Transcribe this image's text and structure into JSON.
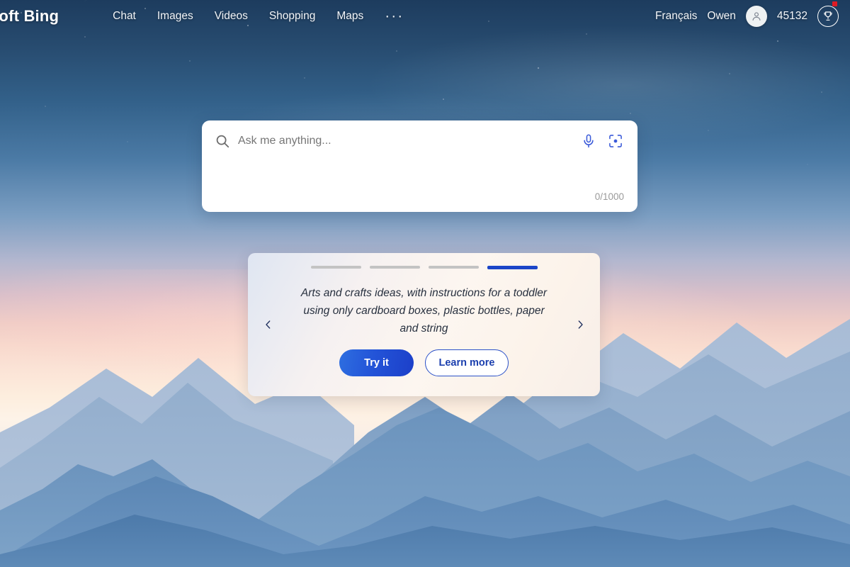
{
  "header": {
    "brand": "soft Bing",
    "nav": [
      {
        "label": "Chat",
        "name": "nav-chat"
      },
      {
        "label": "Images",
        "name": "nav-images"
      },
      {
        "label": "Videos",
        "name": "nav-videos"
      },
      {
        "label": "Shopping",
        "name": "nav-shopping"
      },
      {
        "label": "Maps",
        "name": "nav-maps"
      }
    ],
    "more_label": "···",
    "language": "Français",
    "account_name": "Owen",
    "rewards_points": "45132",
    "avatar_icon": "person-icon",
    "rewards_icon": "trophy-icon",
    "notification_badge": true
  },
  "search": {
    "placeholder": "Ask me anything...",
    "value": "",
    "counter": "0/1000",
    "search_icon": "search-icon",
    "mic_icon": "microphone-icon",
    "visual_icon": "visual-search-icon"
  },
  "suggestion_card": {
    "text": "Arts and crafts ideas, with instructions for a toddler using only cardboard boxes, plastic bottles, paper and string",
    "try_label": "Try it",
    "learn_label": "Learn more",
    "prev_icon": "chevron-left-icon",
    "next_icon": "chevron-right-icon",
    "total_slides": 4,
    "active_slide": 4
  },
  "colors": {
    "accent_blue": "#1b45c8",
    "button_blue": "#2354d8",
    "icon_blue": "#3a5ad9",
    "badge_red": "#e01b24",
    "card_text": "#27303f"
  }
}
